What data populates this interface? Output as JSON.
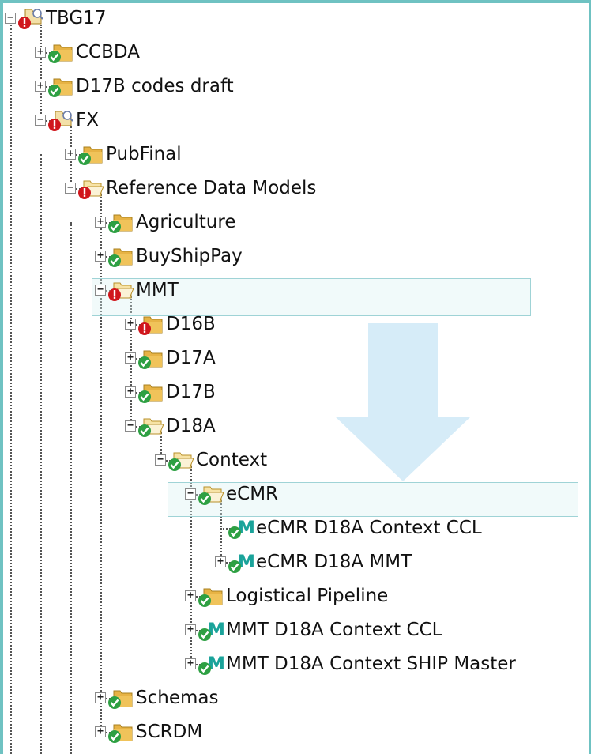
{
  "tree": {
    "nodes": [
      {
        "id": "tbg17",
        "label": "TBG17",
        "level": 0,
        "expander": "minus",
        "icon": "project-warning-icon",
        "status": "warning"
      },
      {
        "id": "ccbda",
        "label": "CCBDA",
        "level": 1,
        "expander": "plus",
        "icon": "folder-ok-icon",
        "status": "ok"
      },
      {
        "id": "d17b-codes-draft",
        "label": "D17B codes draft",
        "level": 1,
        "expander": "plus",
        "icon": "folder-ok-icon",
        "status": "ok"
      },
      {
        "id": "fx",
        "label": "FX",
        "level": 1,
        "expander": "minus",
        "icon": "project-warning-icon",
        "status": "warning"
      },
      {
        "id": "pubfinal",
        "label": "PubFinal",
        "level": 2,
        "expander": "plus",
        "icon": "folder-ok-icon",
        "status": "ok"
      },
      {
        "id": "reference-data-models",
        "label": "Reference Data Models",
        "level": 2,
        "expander": "minus",
        "icon": "folder-open-warning-icon",
        "status": "warning"
      },
      {
        "id": "agriculture",
        "label": "Agriculture",
        "level": 3,
        "expander": "plus",
        "icon": "folder-ok-icon",
        "status": "ok"
      },
      {
        "id": "buyshippay",
        "label": "BuyShipPay",
        "level": 3,
        "expander": "plus",
        "icon": "folder-ok-icon",
        "status": "ok"
      },
      {
        "id": "mmt",
        "label": "MMT",
        "level": 3,
        "expander": "minus",
        "icon": "folder-open-warning-icon",
        "status": "warning"
      },
      {
        "id": "d16b",
        "label": "D16B",
        "level": 4,
        "expander": "plus",
        "icon": "folder-warning-icon",
        "status": "warning"
      },
      {
        "id": "d17a",
        "label": "D17A",
        "level": 4,
        "expander": "plus",
        "icon": "folder-ok-icon",
        "status": "ok"
      },
      {
        "id": "d17b",
        "label": "D17B",
        "level": 4,
        "expander": "plus",
        "icon": "folder-ok-icon",
        "status": "ok"
      },
      {
        "id": "d18a",
        "label": "D18A",
        "level": 4,
        "expander": "minus",
        "icon": "folder-open-ok-icon",
        "status": "ok"
      },
      {
        "id": "context",
        "label": "Context",
        "level": 5,
        "expander": "minus",
        "icon": "folder-open-ok-icon",
        "status": "ok"
      },
      {
        "id": "ecmr",
        "label": "eCMR",
        "level": 6,
        "expander": "minus",
        "icon": "folder-open-ok-icon",
        "status": "ok"
      },
      {
        "id": "ecmr-d18a-context-ccl",
        "label": "eCMR D18A Context CCL",
        "level": 7,
        "expander": "none",
        "icon": "model-ok-icon",
        "status": "ok"
      },
      {
        "id": "ecmr-d18a-mmt",
        "label": "eCMR D18A MMT",
        "level": 7,
        "expander": "plus",
        "icon": "model-ok-icon",
        "status": "ok"
      },
      {
        "id": "logistical-pipeline",
        "label": "Logistical Pipeline",
        "level": 6,
        "expander": "plus",
        "icon": "folder-ok-icon",
        "status": "ok"
      },
      {
        "id": "mmt-d18a-context-ccl",
        "label": "MMT D18A Context CCL",
        "level": 6,
        "expander": "plus",
        "icon": "model-ok-icon",
        "status": "ok"
      },
      {
        "id": "mmt-d18a-context-ship-master",
        "label": "MMT D18A Context SHIP Master",
        "level": 6,
        "expander": "plus",
        "icon": "model-ok-icon",
        "status": "ok"
      },
      {
        "id": "schemas",
        "label": "Schemas",
        "level": 3,
        "expander": "plus",
        "icon": "folder-ok-icon",
        "status": "ok"
      },
      {
        "id": "scrdm",
        "label": "SCRDM",
        "level": 3,
        "expander": "plus",
        "icon": "folder-ok-icon",
        "status": "ok"
      }
    ]
  },
  "highlighted": [
    "mmt",
    "ecmr"
  ],
  "colors": {
    "accent_border": "#6fc2c2",
    "highlight_border": "#9fd3d6",
    "arrow": "#d6ecf8",
    "folder": "#e7b345",
    "ok": "#2ea043",
    "warning": "#d0161c",
    "model": "#1aa39a"
  }
}
